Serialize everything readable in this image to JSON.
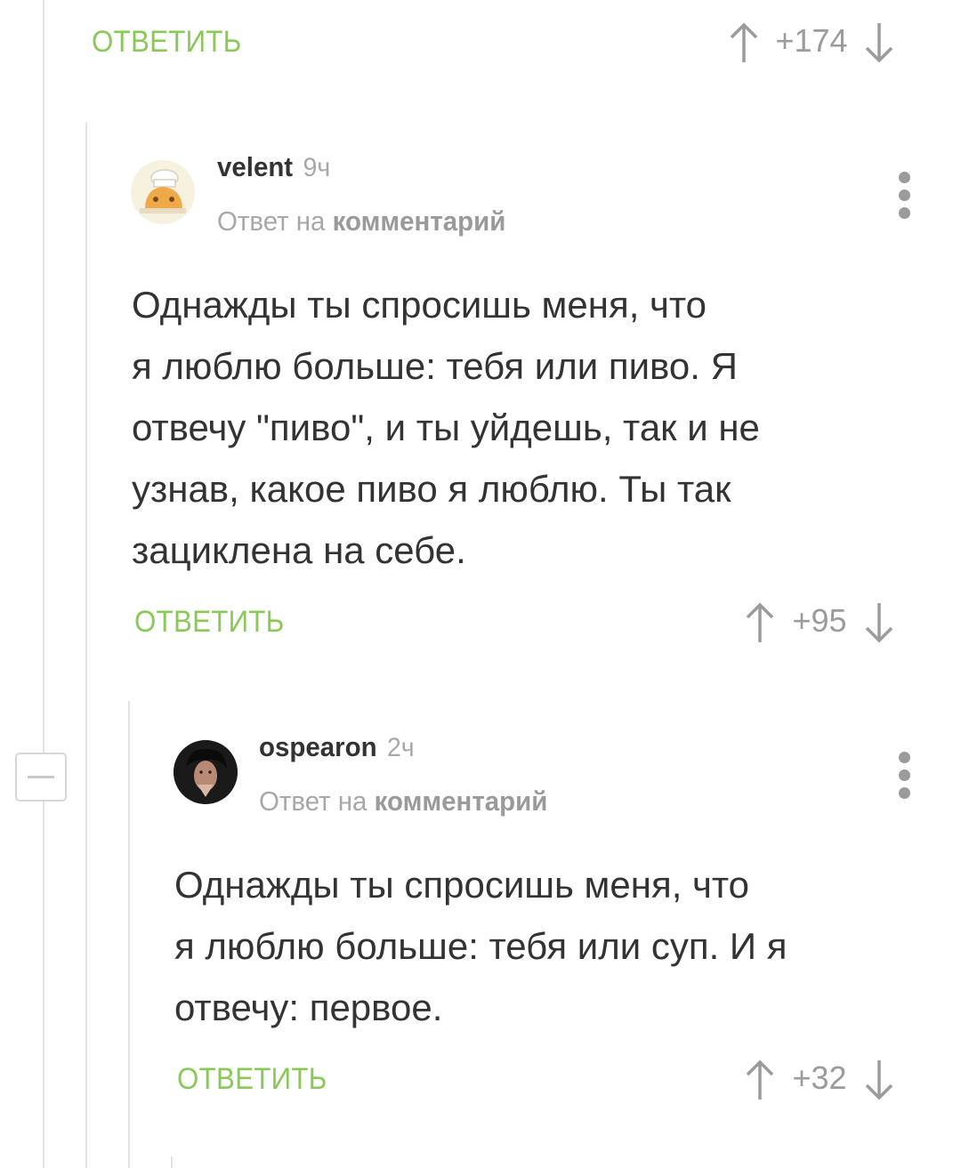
{
  "top_comment": {
    "reply_label": "ОТВЕТИТЬ",
    "score": "+174"
  },
  "comments": [
    {
      "author": "velent",
      "time": "9ч",
      "reply_prefix": "Ответ на",
      "reply_link": "комментарий",
      "text_lines": [
        "Однажды ты спросишь меня, что",
        "я люблю больше: тебя или пиво. Я",
        "отвечу \"пиво\", и ты уйдешь, так и не",
        "узнав, какое пиво я люблю. Ты так",
        "зациклена на себе."
      ],
      "reply_label": "ОТВЕТИТЬ",
      "score": "+95"
    },
    {
      "author": "ospearon",
      "time": "2ч",
      "reply_prefix": "Ответ на",
      "reply_link": "комментарий",
      "text_lines": [
        "Однажды ты спросишь меня, что",
        "я люблю больше: тебя или суп. И я",
        "отвечу: первое."
      ],
      "reply_label": "ОТВЕТИТЬ",
      "score": "+32"
    }
  ],
  "icons": {
    "upvote": "arrow-up-icon",
    "downvote": "arrow-down-icon",
    "more": "more-vertical-icon",
    "collapse": "collapse-minus-icon"
  },
  "colors": {
    "accent_green": "#8ac858",
    "muted_gray": "#9b9b9b",
    "text": "#333333",
    "thread_line": "#e2e2e2"
  }
}
